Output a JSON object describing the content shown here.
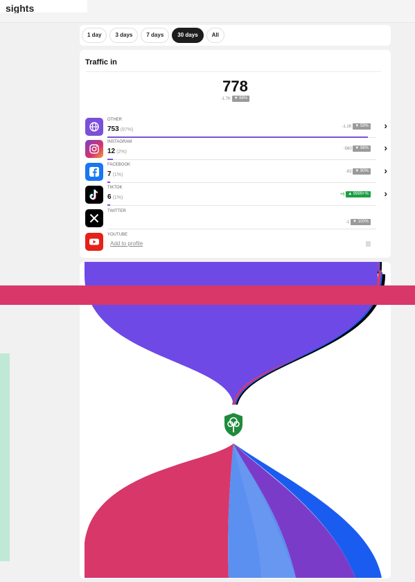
{
  "header": {
    "title_fragment": "sights"
  },
  "time_ranges": [
    {
      "label": "1 day",
      "active": false
    },
    {
      "label": "3 days",
      "active": false
    },
    {
      "label": "7 days",
      "active": false
    },
    {
      "label": "30 days",
      "active": true
    },
    {
      "label": "All",
      "active": false
    }
  ],
  "traffic": {
    "title": "Traffic in",
    "total": "778",
    "total_change": "-1.7K",
    "total_change_pct": "▼ 68%",
    "sources": [
      {
        "name": "OTHER",
        "count": "753",
        "pct": "(97%)",
        "change": "-1.1K",
        "change_pct": "▼ 59%",
        "trend": "down",
        "share": 0.97,
        "color": "#7b4fd8"
      },
      {
        "name": "INSTAGRAM",
        "count": "12",
        "pct": "(2%)",
        "change": "-560",
        "change_pct": "▼ 98%",
        "trend": "down",
        "share": 0.02,
        "color": "#c13584"
      },
      {
        "name": "FACEBOOK",
        "count": "7",
        "pct": "(1%)",
        "change": "-82",
        "change_pct": "▼ 90%",
        "trend": "down",
        "share": 0.01,
        "color": "#1877f2"
      },
      {
        "name": "TIKTOK",
        "count": "6",
        "pct": "(1%)",
        "change": "+6",
        "change_pct": "▲ 9999+%",
        "trend": "up",
        "share": 0.01,
        "color": "#000000"
      },
      {
        "name": "TWITTER",
        "change": "-1",
        "change_pct": "▼ 100%",
        "trend": "down",
        "share": 0,
        "color": "#000000"
      },
      {
        "name": "YOUTUBE",
        "add_label": "Add to profile",
        "color": "#e62117"
      }
    ]
  },
  "icons": [
    "globe-icon",
    "instagram-icon",
    "facebook-icon",
    "tiktok-icon",
    "x-twitter-icon",
    "youtube-icon",
    "chevron-right-icon",
    "tree-shield-icon"
  ],
  "colors": {
    "accent_purple": "#6e49e6",
    "accent_pink": "#d8376a",
    "accent_blue": "#5b8ff0",
    "accent_bright_blue": "#1b5cf0",
    "accent_violet": "#7a3cc8",
    "brand_green": "#1f8a3b"
  }
}
